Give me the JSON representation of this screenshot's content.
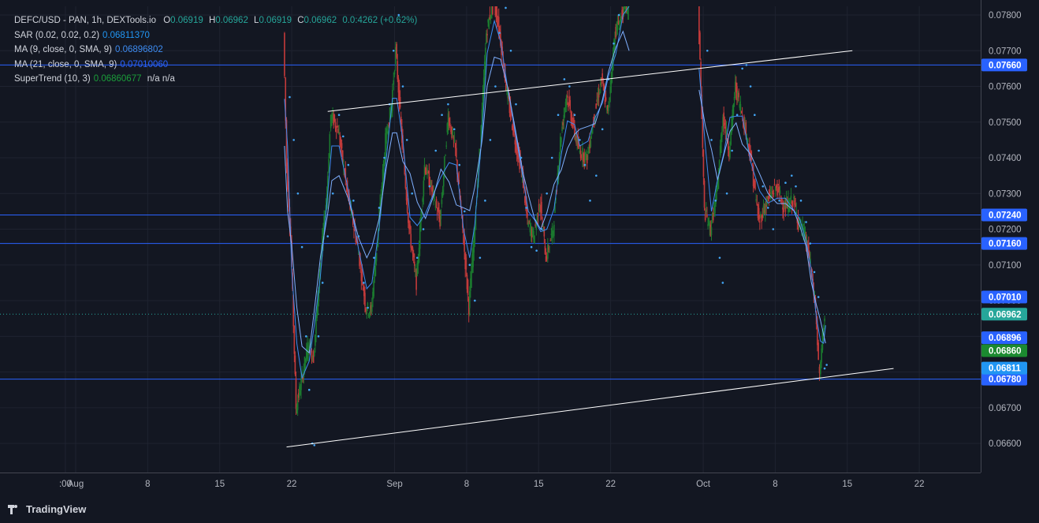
{
  "legend": {
    "symbol": "DEFC/USD - PAN, 1h, DEXTools.io",
    "ohlc": {
      "o_label": "O",
      "o": "0.06919",
      "h_label": "H",
      "h": "0.06962",
      "l_label": "L",
      "l": "0.06919",
      "c_label": "C",
      "c": "0.06962",
      "change": "0.0:4262 (+0.62%)"
    },
    "sar": {
      "label": "SAR (0.02, 0.02, 0.2)",
      "value": "0.06811370"
    },
    "ma9": {
      "label": "MA (9, close, 0, SMA, 9)",
      "value": "0.06896802"
    },
    "ma21": {
      "label": "MA (21, close, 0, SMA, 9)",
      "value": "0.07010060"
    },
    "supertrend": {
      "label": "SuperTrend (10, 3)",
      "value": "0.06860677",
      "extra": "n/a  n/a"
    }
  },
  "footer": {
    "brand": "TradingView"
  },
  "colors": {
    "background": "#131722",
    "grid": "#1f2330",
    "hline": "#2962ff",
    "trendline": "#ffffff",
    "sar": "#42a5f5",
    "candle_up": "#1b7a2e",
    "candle_down": "#c23a3a",
    "ma9": "#3d8bf0",
    "ma21": "#7fb0ff",
    "legend_value": "#26a69a",
    "sar_value": "#2196f3",
    "st_value": "#1b9e3a"
  },
  "chart_data": {
    "type": "candlestick",
    "y_axis": {
      "min": 0.0655,
      "max": 0.0784,
      "ticks": [
        "0.07800",
        "0.07700",
        "0.07600",
        "0.07500",
        "0.07400",
        "0.07300",
        "0.07200",
        "0.07100",
        "0.07000",
        "0.06900",
        "0.06800",
        "0.06700",
        "0.06600"
      ]
    },
    "x_axis": {
      "ticks": [
        {
          "label": ":00",
          "day": -1
        },
        {
          "label": "Aug",
          "day": 0
        },
        {
          "label": "8",
          "day": 7
        },
        {
          "label": "15",
          "day": 14
        },
        {
          "label": "22",
          "day": 21
        },
        {
          "label": "Sep",
          "day": 31
        },
        {
          "label": "8",
          "day": 38
        },
        {
          "label": "15",
          "day": 45
        },
        {
          "label": "22",
          "day": 52
        },
        {
          "label": "Oct",
          "day": 61
        },
        {
          "label": "8",
          "day": 68
        },
        {
          "label": "15",
          "day": 75
        },
        {
          "label": "22",
          "day": 82
        }
      ]
    },
    "horizontal_lines": [
      {
        "value": 0.0766,
        "label": "0.07660"
      },
      {
        "value": 0.0724,
        "label": "0.07240"
      },
      {
        "value": 0.0716,
        "label": "0.07160"
      },
      {
        "value": 0.0678,
        "label": "0.06780"
      }
    ],
    "price_badges": [
      {
        "value": 0.0701,
        "label": "0.07010",
        "color": "#2962ff"
      },
      {
        "value": 0.06962,
        "label": "0.06962",
        "color": "#26a69a"
      },
      {
        "value": 0.06896,
        "label": "0.06896",
        "color": "#2962ff"
      },
      {
        "value": 0.0686,
        "label": "0.06860",
        "color": "#1b8a30"
      },
      {
        "value": 0.06811,
        "label": "0.06811",
        "color": "#2196f3"
      }
    ],
    "last_price": 0.06962,
    "trendlines": [
      {
        "from": {
          "day": 24.5,
          "value": 0.0753
        },
        "to": {
          "day": 75.5,
          "value": 0.077
        }
      },
      {
        "from": {
          "day": 20.5,
          "value": 0.0659
        },
        "to": {
          "day": 79.5,
          "value": 0.0681
        }
      }
    ],
    "price_path": [
      [
        20.3,
        0.0775
      ],
      [
        20.6,
        0.0738
      ],
      [
        21.0,
        0.0717
      ],
      [
        21.5,
        0.067
      ],
      [
        22.0,
        0.0677
      ],
      [
        22.7,
        0.0688
      ],
      [
        23.2,
        0.0684
      ],
      [
        23.8,
        0.0708
      ],
      [
        24.5,
        0.073
      ],
      [
        24.9,
        0.0752
      ],
      [
        25.6,
        0.0748
      ],
      [
        26.5,
        0.073
      ],
      [
        27.5,
        0.0715
      ],
      [
        28.3,
        0.0698
      ],
      [
        28.8,
        0.0697
      ],
      [
        29.5,
        0.072
      ],
      [
        30.2,
        0.0745
      ],
      [
        30.8,
        0.0755
      ],
      [
        31.2,
        0.077
      ],
      [
        31.8,
        0.0745
      ],
      [
        32.5,
        0.072
      ],
      [
        33.2,
        0.0705
      ],
      [
        34.0,
        0.0738
      ],
      [
        34.8,
        0.073
      ],
      [
        35.5,
        0.0722
      ],
      [
        36.3,
        0.0752
      ],
      [
        37.0,
        0.0742
      ],
      [
        37.7,
        0.072
      ],
      [
        38.3,
        0.0698
      ],
      [
        38.8,
        0.0718
      ],
      [
        39.5,
        0.0748
      ],
      [
        40.0,
        0.0775
      ],
      [
        40.7,
        0.0785
      ],
      [
        41.3,
        0.0775
      ],
      [
        42.0,
        0.0758
      ],
      [
        42.8,
        0.0745
      ],
      [
        43.5,
        0.0735
      ],
      [
        44.0,
        0.0722
      ],
      [
        44.6,
        0.0718
      ],
      [
        45.2,
        0.0728
      ],
      [
        45.8,
        0.0712
      ],
      [
        46.5,
        0.072
      ],
      [
        47.2,
        0.0745
      ],
      [
        47.8,
        0.0758
      ],
      [
        48.5,
        0.0748
      ],
      [
        49.0,
        0.0742
      ],
      [
        49.8,
        0.074
      ],
      [
        50.5,
        0.0752
      ],
      [
        51.2,
        0.0762
      ],
      [
        51.8,
        0.0752
      ],
      [
        52.5,
        0.0775
      ],
      [
        53.2,
        0.078
      ],
      [
        53.8,
        0.0785
      ],
      [
        60.6,
        0.0785
      ],
      [
        61.2,
        0.0725
      ],
      [
        61.8,
        0.072
      ],
      [
        62.4,
        0.073
      ],
      [
        63.0,
        0.0752
      ],
      [
        63.6,
        0.0742
      ],
      [
        64.2,
        0.076
      ],
      [
        64.8,
        0.0753
      ],
      [
        65.6,
        0.0742
      ],
      [
        66.5,
        0.0722
      ],
      [
        67.3,
        0.0728
      ],
      [
        68.2,
        0.0732
      ],
      [
        69.0,
        0.0726
      ],
      [
        69.8,
        0.0728
      ],
      [
        70.4,
        0.0722
      ],
      [
        71.0,
        0.0718
      ],
      [
        71.5,
        0.071
      ],
      [
        72.0,
        0.0698
      ],
      [
        72.4,
        0.0678
      ],
      [
        72.7,
        0.069
      ],
      [
        72.9,
        0.06962
      ]
    ],
    "sar_points": [
      [
        20.8,
        0.0757
      ],
      [
        21.2,
        0.0745
      ],
      [
        21.6,
        0.073
      ],
      [
        22.0,
        0.0715
      ],
      [
        22.4,
        0.069
      ],
      [
        22.7,
        0.0675
      ],
      [
        23.0,
        0.066
      ],
      [
        23.2,
        0.06595
      ],
      [
        23.6,
        0.069
      ],
      [
        24.0,
        0.0705
      ],
      [
        24.5,
        0.0718
      ],
      [
        25.0,
        0.073
      ],
      [
        25.6,
        0.0752
      ],
      [
        26.0,
        0.0746
      ],
      [
        26.5,
        0.0738
      ],
      [
        27.0,
        0.0728
      ],
      [
        27.5,
        0.0718
      ],
      [
        28.0,
        0.0705
      ],
      [
        28.4,
        0.0698
      ],
      [
        29.0,
        0.0712
      ],
      [
        29.5,
        0.0726
      ],
      [
        30.0,
        0.074
      ],
      [
        30.5,
        0.0755
      ],
      [
        30.9,
        0.077
      ],
      [
        31.4,
        0.078
      ],
      [
        31.8,
        0.076
      ],
      [
        32.2,
        0.0745
      ],
      [
        32.7,
        0.073
      ],
      [
        33.2,
        0.0712
      ],
      [
        33.8,
        0.072
      ],
      [
        34.4,
        0.0732
      ],
      [
        35.0,
        0.0742
      ],
      [
        35.6,
        0.0752
      ],
      [
        36.2,
        0.0755
      ],
      [
        36.8,
        0.0748
      ],
      [
        37.3,
        0.0738
      ],
      [
        37.8,
        0.0725
      ],
      [
        38.3,
        0.071
      ],
      [
        38.8,
        0.07
      ],
      [
        39.3,
        0.0712
      ],
      [
        39.8,
        0.0728
      ],
      [
        40.3,
        0.0745
      ],
      [
        40.8,
        0.076
      ],
      [
        41.2,
        0.0775
      ],
      [
        41.8,
        0.0782
      ],
      [
        42.3,
        0.077
      ],
      [
        42.8,
        0.0755
      ],
      [
        43.3,
        0.074
      ],
      [
        43.8,
        0.0726
      ],
      [
        44.3,
        0.0715
      ],
      [
        44.8,
        0.0714
      ],
      [
        45.3,
        0.072
      ],
      [
        45.8,
        0.073
      ],
      [
        46.3,
        0.074
      ],
      [
        46.9,
        0.0752
      ],
      [
        47.5,
        0.0762
      ],
      [
        48.0,
        0.076
      ],
      [
        48.5,
        0.0752
      ],
      [
        49.0,
        0.0745
      ],
      [
        49.5,
        0.0738
      ],
      [
        50.0,
        0.0728
      ],
      [
        50.6,
        0.0735
      ],
      [
        51.2,
        0.0748
      ],
      [
        51.8,
        0.0762
      ],
      [
        52.3,
        0.0772
      ],
      [
        52.8,
        0.078
      ],
      [
        53.3,
        0.0785
      ],
      [
        61.4,
        0.077
      ],
      [
        61.8,
        0.0745
      ],
      [
        62.2,
        0.0728
      ],
      [
        62.6,
        0.0712
      ],
      [
        62.9,
        0.0705
      ],
      [
        63.3,
        0.073
      ],
      [
        63.8,
        0.0742
      ],
      [
        64.3,
        0.0752
      ],
      [
        64.8,
        0.0765
      ],
      [
        65.2,
        0.0766
      ],
      [
        65.6,
        0.076
      ],
      [
        66.0,
        0.0752
      ],
      [
        66.4,
        0.0742
      ],
      [
        66.8,
        0.0732
      ],
      [
        67.3,
        0.0726
      ],
      [
        67.8,
        0.072
      ],
      [
        68.4,
        0.0728
      ],
      [
        69.0,
        0.0733
      ],
      [
        69.6,
        0.0735
      ],
      [
        70.0,
        0.0732
      ],
      [
        70.5,
        0.0728
      ],
      [
        71.0,
        0.0722
      ],
      [
        71.4,
        0.0716
      ],
      [
        71.8,
        0.0708
      ],
      [
        72.2,
        0.0701
      ],
      [
        72.8,
        0.0681
      ],
      [
        73.0,
        0.0682
      ]
    ]
  }
}
